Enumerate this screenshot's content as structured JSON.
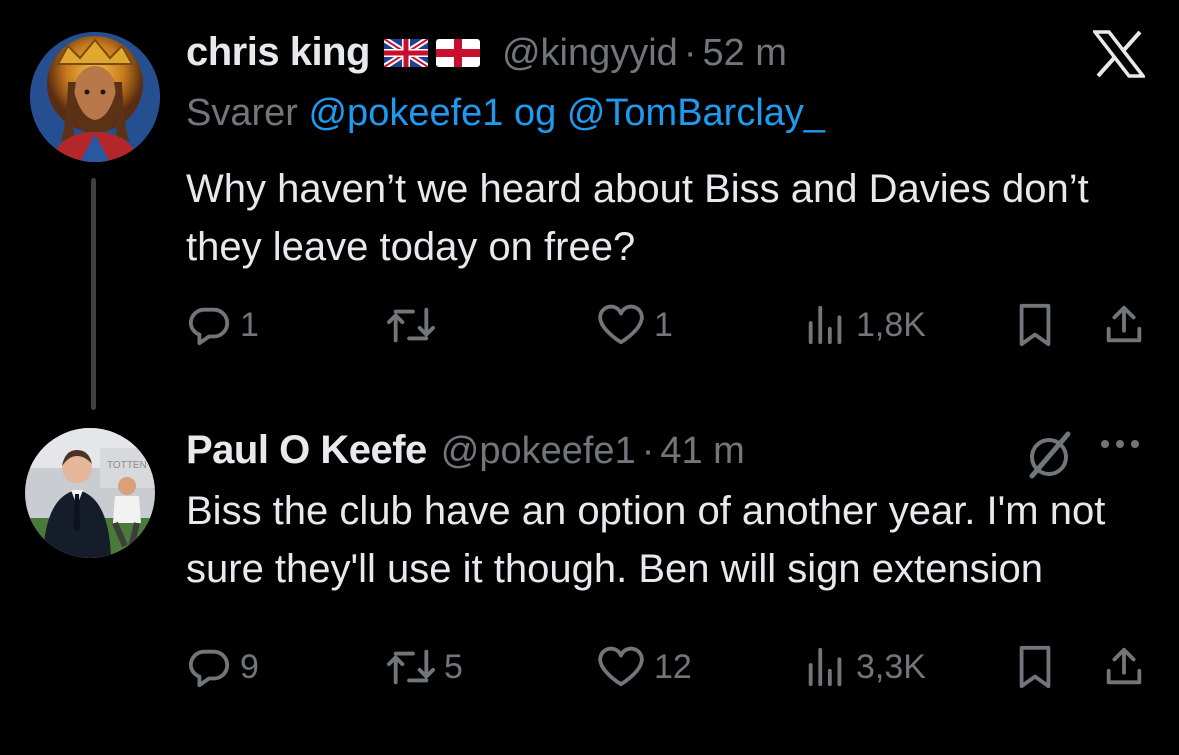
{
  "tweet1": {
    "name": "chris king",
    "handle": "@kingyyid",
    "time": "52 m",
    "replying_prefix": "Svarer",
    "replying_mention1": "@pokeefe1",
    "replying_conj": "og",
    "replying_mention2": "@TomBarclay_",
    "text": "Why haven’t we heard about Biss and Davies don’t they leave today on free?",
    "replies": "1",
    "retweets": "",
    "likes": "1",
    "views": "1,8K"
  },
  "tweet2": {
    "name": "Paul O Keefe",
    "handle": "@pokeefe1",
    "time": "41 m",
    "text": "Biss the club have an option of another year. I'm not sure they'll use it though. Ben will sign extension",
    "replies": "9",
    "retweets": "5",
    "likes": "12",
    "views": "3,3K"
  },
  "colors": {
    "background": "#000000",
    "text": "#e7e9ea",
    "muted": "#71767b",
    "link": "#1d9bf0"
  }
}
